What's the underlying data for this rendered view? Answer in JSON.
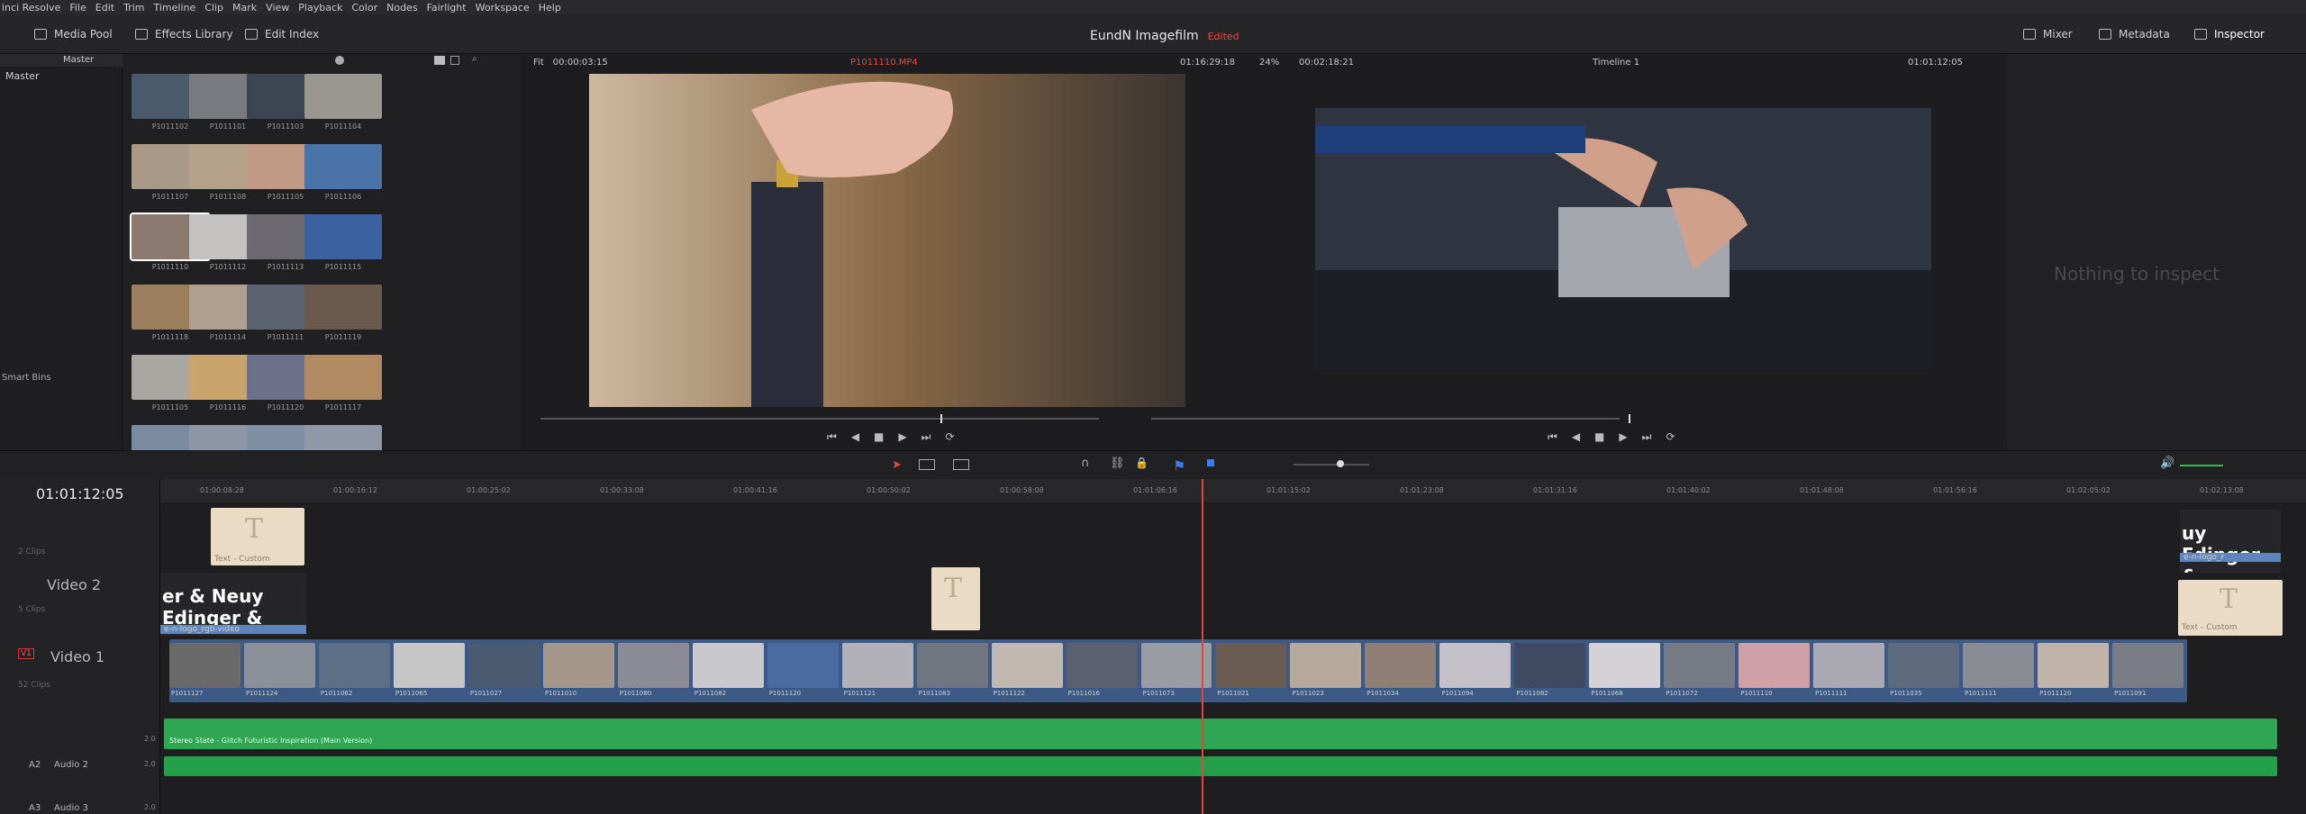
{
  "menu": [
    "inci Resolve",
    "File",
    "Edit",
    "Trim",
    "Timeline",
    "Clip",
    "Mark",
    "View",
    "Playback",
    "Color",
    "Nodes",
    "Fairlight",
    "Workspace",
    "Help"
  ],
  "toolbar": {
    "media_pool": "Media Pool",
    "effects_library": "Effects Library",
    "edit_index": "Edit Index",
    "mixer": "Mixer",
    "metadata": "Metadata",
    "inspector": "Inspector"
  },
  "project": {
    "title": "EundN Imagefilm",
    "status": "Edited"
  },
  "bins": {
    "master_header": "Master",
    "master_item": "Master",
    "smart_bins": "Smart Bins"
  },
  "viewer": {
    "fit": "Fit",
    "src_tc": "00:00:03:15",
    "src_clip": "P1011110.MP4",
    "src_dur": "01:16:29:18",
    "zoom": "24%",
    "rec_tc": "00:02:18:21",
    "timeline": "Timeline 1",
    "rec_pos": "01:01:12:05"
  },
  "inspector": {
    "empty": "Nothing to inspect"
  },
  "media_items": [
    {
      "label": "P1011102",
      "color": "#4b5a6a"
    },
    {
      "label": "P1011101",
      "color": "#7a7b80"
    },
    {
      "label": "P1011103",
      "color": "#3c4550"
    },
    {
      "label": "P1011104",
      "color": "#9a9690"
    },
    {
      "label": "P1011107",
      "color": "#a89a86"
    },
    {
      "label": "P1011108",
      "color": "#b5a08a"
    },
    {
      "label": "P1011105",
      "color": "#c09a84"
    },
    {
      "label": "P1011106",
      "color": "#4a74a8"
    },
    {
      "label": "P1011110",
      "color": "#8a7a70"
    },
    {
      "label": "P1011112",
      "color": "#c4c2c0"
    },
    {
      "label": "P1011113",
      "color": "#6c6a70"
    },
    {
      "label": "P1011115",
      "color": "#3a62a0"
    },
    {
      "label": "P1011118",
      "color": "#9a7e5e"
    },
    {
      "label": "P1011114",
      "color": "#b0a090"
    },
    {
      "label": "P1011111",
      "color": "#5c6270"
    },
    {
      "label": "P1011119",
      "color": "#6a5a4e"
    },
    {
      "label": "P1011105",
      "color": "#a9a7a2"
    },
    {
      "label": "P1011116",
      "color": "#c9a56d"
    },
    {
      "label": "P1011120",
      "color": "#6c7088"
    },
    {
      "label": "P1011117",
      "color": "#b08a60"
    },
    {
      "label": "",
      "color": "#7a8aa0"
    },
    {
      "label": "",
      "color": "#8c96a6"
    },
    {
      "label": "",
      "color": "#7f8fa4"
    },
    {
      "label": "",
      "color": "#9098a8"
    }
  ],
  "timeline": {
    "timecode": "01:01:12:05",
    "ruler": [
      "01:00:08:28",
      "01:00:16:12",
      "01:00:25:02",
      "01:00:33:08",
      "01:00:41:16",
      "01:00:50:02",
      "01:00:58:08",
      "01:01:06:16",
      "01:01:15:02",
      "01:01:23:08",
      "01:01:31:16",
      "01:01:40:02",
      "01:01:48:08",
      "01:01:56:16",
      "01:02:05:02",
      "01:02:13:08"
    ],
    "tracks": {
      "v3_clips": "2 Clips",
      "v2_name": "Video 2",
      "v2_clips": "5 Clips",
      "v1_tag": "V1",
      "v1_name": "Video 1",
      "v1_clips": "52 Clips",
      "a2_tag": "A2",
      "a2_name": "Audio 2",
      "a2_ch": "2.0",
      "a3_tag": "A3",
      "a3_name": "Audio 3",
      "a3_ch": "2.0",
      "a1_ch": "2.0"
    },
    "clips": {
      "text1": "Text - Custom",
      "logo": "e-n-logo_rgb-video",
      "logo_text": "er & Neuy  Edinger &",
      "audio": "Stereo State - Glitch Futuristic Inspiration (Main Version)",
      "edge_logo": "uy Edinger &",
      "edge_label": "e-n-logo_r",
      "edge_text": "Text - Custom"
    },
    "v1_labels": [
      "P1011127",
      "P1011124",
      "P1011062",
      "P1011065",
      "P1011027",
      "P1011010",
      "P1011080",
      "P1011082",
      "P1011120",
      "P1011121",
      "P1011083",
      "P1011122",
      "P1011016",
      "P1011073",
      "P1011021",
      "P1011023",
      "P1011034",
      "P1011094",
      "P1011082",
      "P1011068",
      "P1011072",
      "P1011110",
      "P1011111",
      "P1011035",
      "P1011111",
      "P1011120",
      "P1011091"
    ],
    "v1_colors": [
      "#6a6a6a",
      "#8a8f98",
      "#5d6f86",
      "#c6c6c6",
      "#4a5a70",
      "#a49688",
      "#8c8c96",
      "#c8c8cc",
      "#4a6aa0",
      "#b0b0b6",
      "#707680",
      "#c0b8b0",
      "#5a6070",
      "#9a9ca4",
      "#6a5c50",
      "#b6a89a",
      "#8e7e74",
      "#c3c0c8",
      "#3e4a62",
      "#d4d2d6",
      "#767a84",
      "#d0a0a8",
      "#aaa8b0",
      "#5e6a7e",
      "#8a8c94",
      "#c0b4aa",
      "#7a7c86"
    ]
  }
}
